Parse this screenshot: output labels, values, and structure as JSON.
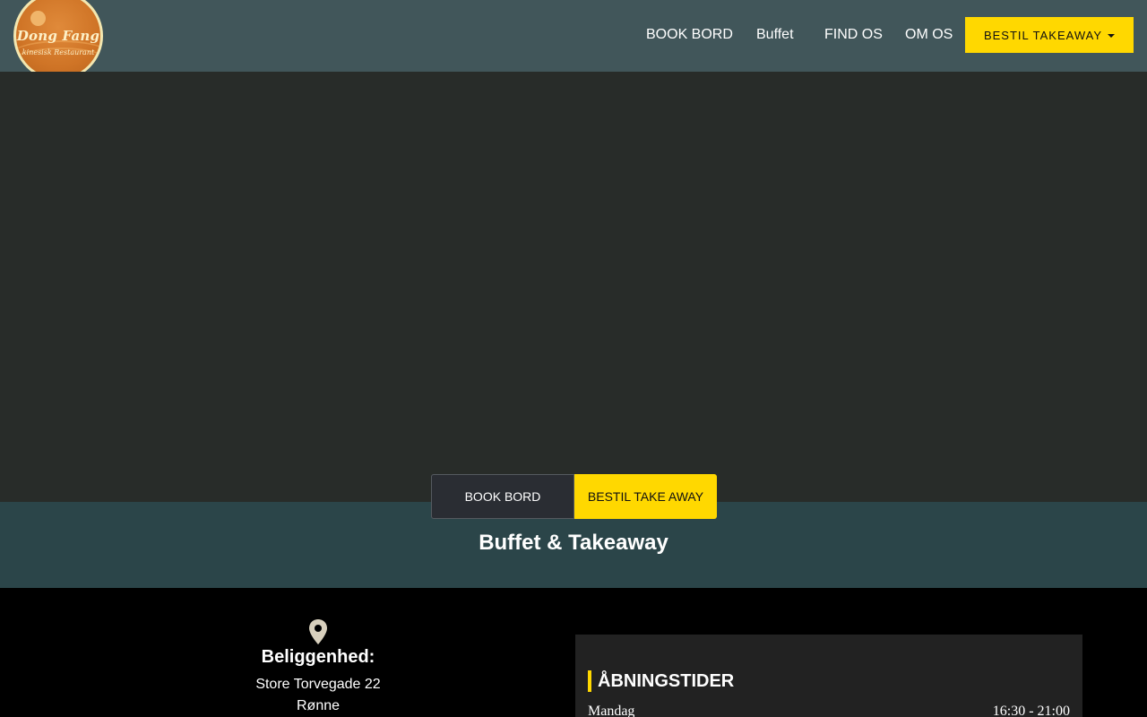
{
  "logo": {
    "name": "Dong Fang",
    "subtitle": "kinesisk Restaurant"
  },
  "nav": {
    "book": "BOOK BORD",
    "buffet": "Buffet",
    "find": "FIND OS",
    "about": "OM OS",
    "order": "BESTIL TAKEAWAY"
  },
  "hero": {
    "book_button": "BOOK BORD",
    "takeaway_button": "BESTIL TAKE AWAY"
  },
  "band": {
    "title": "Buffet & Takeaway"
  },
  "location": {
    "title": "Beliggenhed:",
    "street": "Store Torvegade 22",
    "city": "Rønne"
  },
  "hours": {
    "title": "ÅBNINGSTIDER",
    "rows": [
      {
        "day": "Mandag",
        "time": "16:30 - 21:00"
      }
    ]
  },
  "colors": {
    "accent": "#ffd800",
    "header": "#41565a",
    "band": "#2b4549",
    "hero": "#282c29"
  },
  "icons": {
    "location": "map-pin-icon",
    "dropdown": "caret-down-icon"
  }
}
